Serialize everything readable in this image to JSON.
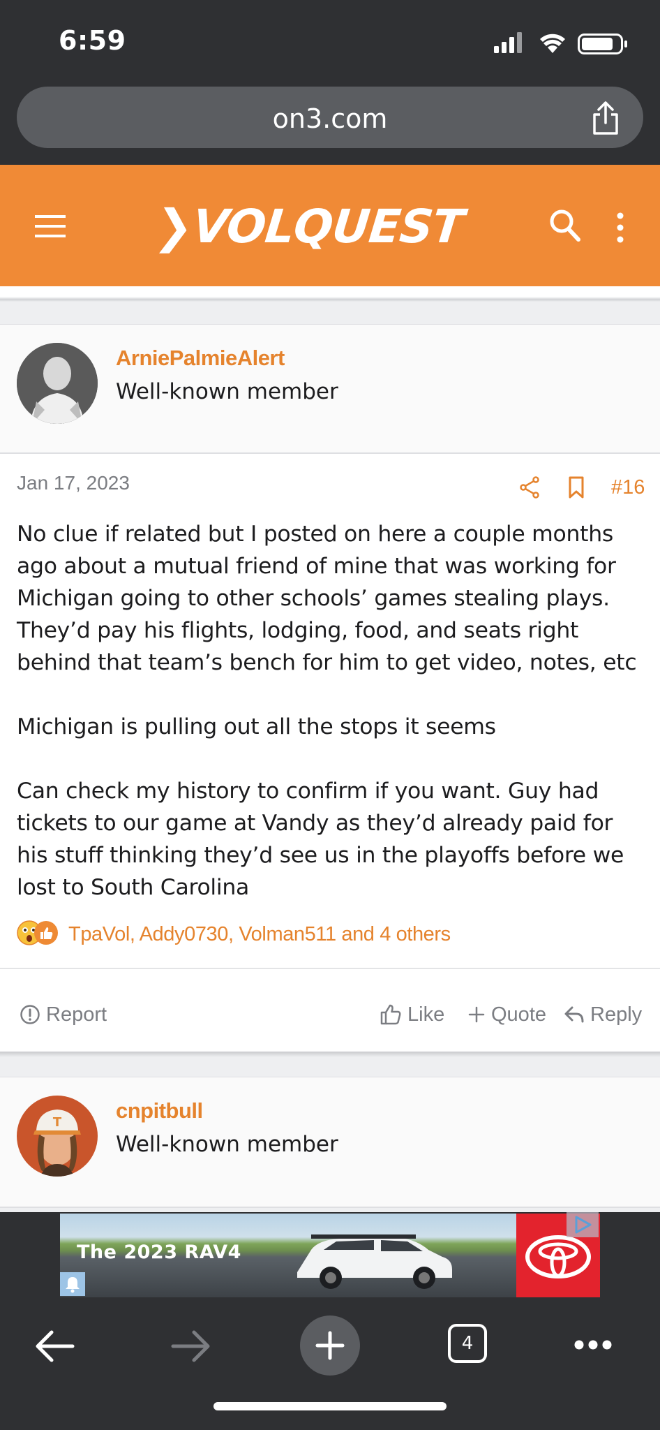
{
  "status_bar": {
    "time": "6:59",
    "icons": [
      "signal-icon",
      "wifi-icon",
      "battery-icon"
    ]
  },
  "browser": {
    "url": "on3.com",
    "open_tabs": "4"
  },
  "site": {
    "logo": "VOLQUEST",
    "brand_color": "#f08a36"
  },
  "posts": [
    {
      "username": "ArniePalmieAlert",
      "user_title": "Well-known member",
      "date": "Jan 17, 2023",
      "number": "#16",
      "paragraphs": [
        "No clue if related but I posted on here a couple months ago about a mutual friend of mine that was working for Michigan going to other schools’ games stealing plays. They’d pay his flights, lodging, food, and seats right behind that team’s bench for him to get video, notes, etc",
        "Michigan is pulling out all the stops it seems",
        "Can check my history to confirm if you want. Guy had tickets to our game at Vandy as they’d already paid for his stuff thinking they’d see us in the playoffs before we lost to South Carolina"
      ],
      "reactions": {
        "icons": [
          "wow-emoji-icon",
          "like-emoji-icon"
        ],
        "names": "TpaVol, Addy0730, Volman511 and 4 others"
      },
      "actions": {
        "report": "Report",
        "like": "Like",
        "quote": "Quote",
        "reply": "Reply"
      }
    },
    {
      "username": "cnpitbull",
      "user_title": "Well-known member"
    }
  ],
  "ad": {
    "text": "The 2023 RAV4"
  }
}
